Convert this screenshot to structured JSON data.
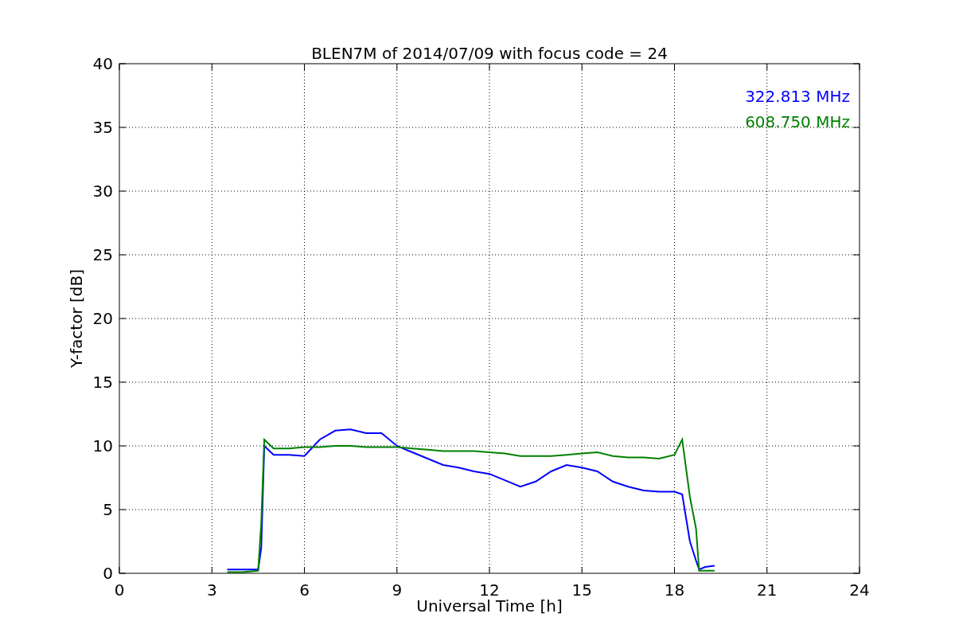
{
  "chart_data": {
    "type": "line",
    "title": "BLEN7M of 2014/07/09 with focus code = 24",
    "xlabel": "Universal Time [h]",
    "ylabel": "Y-factor [dB]",
    "x": [
      3.5,
      4,
      4.5,
      4.6,
      4.7,
      5,
      5.5,
      6,
      6.5,
      7,
      7.5,
      8,
      8.5,
      9,
      9.5,
      10,
      10.5,
      11,
      11.5,
      12,
      12.5,
      13,
      13.5,
      14,
      14.5,
      15,
      15.5,
      16,
      16.5,
      17,
      17.5,
      18,
      18.25,
      18.5,
      18.7,
      18.8,
      19,
      19.3
    ],
    "series": [
      {
        "name": "322.813 MHz",
        "color": "#0000ff",
        "values": [
          0.3,
          0.3,
          0.3,
          2,
          10,
          9.3,
          9.3,
          9.2,
          10.5,
          11.2,
          11.3,
          11,
          11,
          10,
          9.5,
          9,
          8.5,
          8.3,
          8,
          7.8,
          7.3,
          6.8,
          7.2,
          8,
          8.5,
          8.3,
          8,
          7.2,
          6.8,
          6.5,
          6.4,
          6.4,
          6.2,
          2.5,
          1,
          0.3,
          0.5,
          0.6
        ]
      },
      {
        "name": "608.750 MHz",
        "color": "#008000",
        "values": [
          0.1,
          0.1,
          0.2,
          4,
          10.5,
          9.8,
          9.8,
          9.9,
          9.9,
          10,
          10,
          9.9,
          9.9,
          9.9,
          9.8,
          9.7,
          9.6,
          9.6,
          9.6,
          9.5,
          9.4,
          9.2,
          9.2,
          9.2,
          9.3,
          9.4,
          9.5,
          9.2,
          9.1,
          9.1,
          9.0,
          9.3,
          10.5,
          6,
          3.5,
          0.2,
          0.2,
          0.2
        ]
      }
    ],
    "xlim": [
      0,
      24
    ],
    "ylim": [
      0,
      40
    ],
    "xticks": [
      0,
      3,
      6,
      9,
      12,
      15,
      18,
      21,
      24
    ],
    "yticks": [
      0,
      5,
      10,
      15,
      20,
      25,
      30,
      35,
      40
    ],
    "grid": true
  }
}
